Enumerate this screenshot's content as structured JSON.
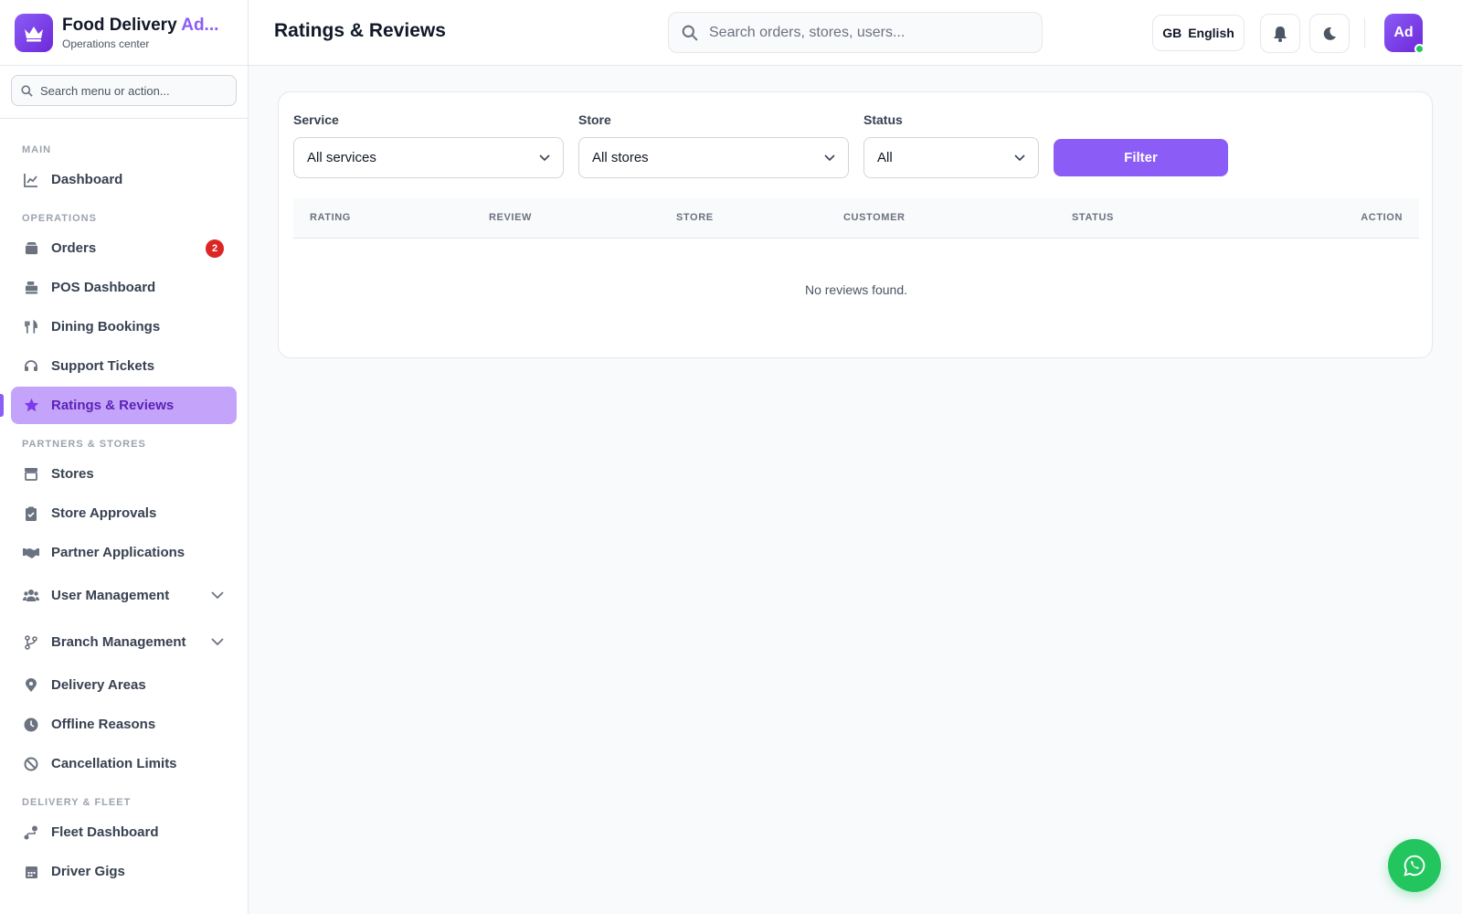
{
  "brand": {
    "title_main": "Food Delivery ",
    "title_accent": "Ad...",
    "subtitle": "Operations center"
  },
  "sidebar": {
    "search_placeholder": "Search menu or action...",
    "sections": {
      "main": "MAIN",
      "operations": "OPERATIONS",
      "partners": "PARTNERS & STORES",
      "fleet": "DELIVERY & FLEET"
    },
    "items": {
      "dashboard": "Dashboard",
      "orders": "Orders",
      "orders_badge": "2",
      "pos": "POS Dashboard",
      "dining": "Dining Bookings",
      "support": "Support Tickets",
      "ratings": "Ratings & Reviews",
      "stores": "Stores",
      "store_approvals": "Store Approvals",
      "partner_apps": "Partner Applications",
      "user_mgmt": "User Management",
      "branch_mgmt": "Branch Management",
      "delivery_areas": "Delivery Areas",
      "offline_reasons": "Offline Reasons",
      "cancel_limits": "Cancellation Limits",
      "fleet_dashboard": "Fleet Dashboard",
      "driver_gigs": "Driver Gigs"
    }
  },
  "header": {
    "title": "Ratings & Reviews",
    "search_placeholder": "Search orders, stores, users...",
    "lang_flag": "GB",
    "lang_label": "English",
    "avatar": "Ad"
  },
  "filters": {
    "service_label": "Service",
    "service_value": "All services",
    "store_label": "Store",
    "store_value": "All stores",
    "status_label": "Status",
    "status_value": "All",
    "button": "Filter"
  },
  "table": {
    "columns": [
      "RATING",
      "REVIEW",
      "STORE",
      "CUSTOMER",
      "STATUS",
      "ACTION"
    ],
    "empty": "No reviews found."
  },
  "colors": {
    "accent": "#8b5cf6",
    "active_bg": "#c4a4fa",
    "badge": "#dc2626",
    "whatsapp": "#22c55e"
  }
}
